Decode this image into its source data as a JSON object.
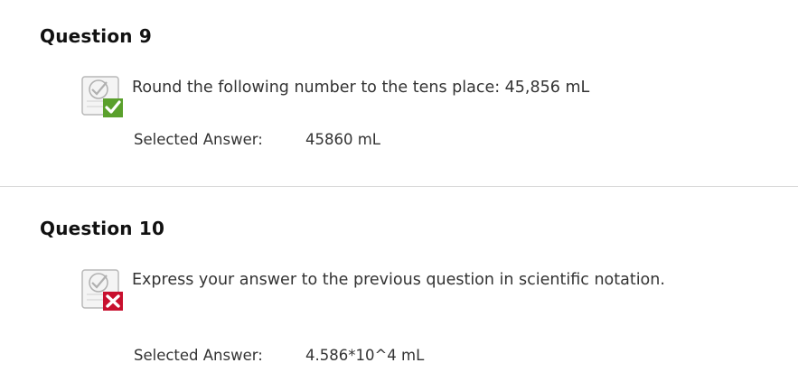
{
  "questions": [
    {
      "title": "Question 9",
      "text": "Round the following number to the tens place:  45,856 mL",
      "status_icon": "correct-checkmark-icon",
      "status_color": "#5aa02c",
      "selected_answer_label": "Selected Answer:",
      "selected_answer_value": "45860 mL"
    },
    {
      "title": "Question 10",
      "text": "Express your answer to the previous question in scientific notation.",
      "status_icon": "incorrect-x-icon",
      "status_color": "#c8102e",
      "selected_answer_label": "Selected Answer:",
      "selected_answer_value": "4.586*10^4 mL"
    }
  ]
}
